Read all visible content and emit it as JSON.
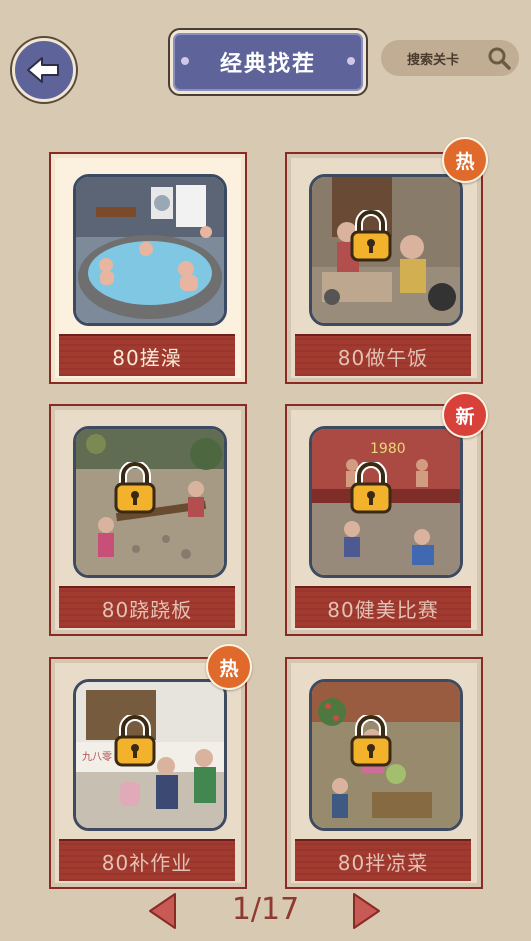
{
  "header": {
    "title": "经典找茬",
    "search_label": "搜索关卡"
  },
  "levels": [
    {
      "name": "80搓澡",
      "locked": false,
      "badge": ""
    },
    {
      "name": "80做午饭",
      "locked": true,
      "badge": "热"
    },
    {
      "name": "80跷跷板",
      "locked": true,
      "badge": ""
    },
    {
      "name": "80健美比赛",
      "locked": true,
      "badge": "新"
    },
    {
      "name": "80补作业",
      "locked": true,
      "badge": "热"
    },
    {
      "name": "80拌凉菜",
      "locked": true,
      "badge": ""
    }
  ],
  "pager": {
    "text": "1/17"
  },
  "colors": {
    "background": "#d8c9b2",
    "plaque": "#5e6499",
    "card_banner": "#a23a30",
    "badge_hot": "#e06a2c",
    "badge_new": "#d8403a"
  }
}
